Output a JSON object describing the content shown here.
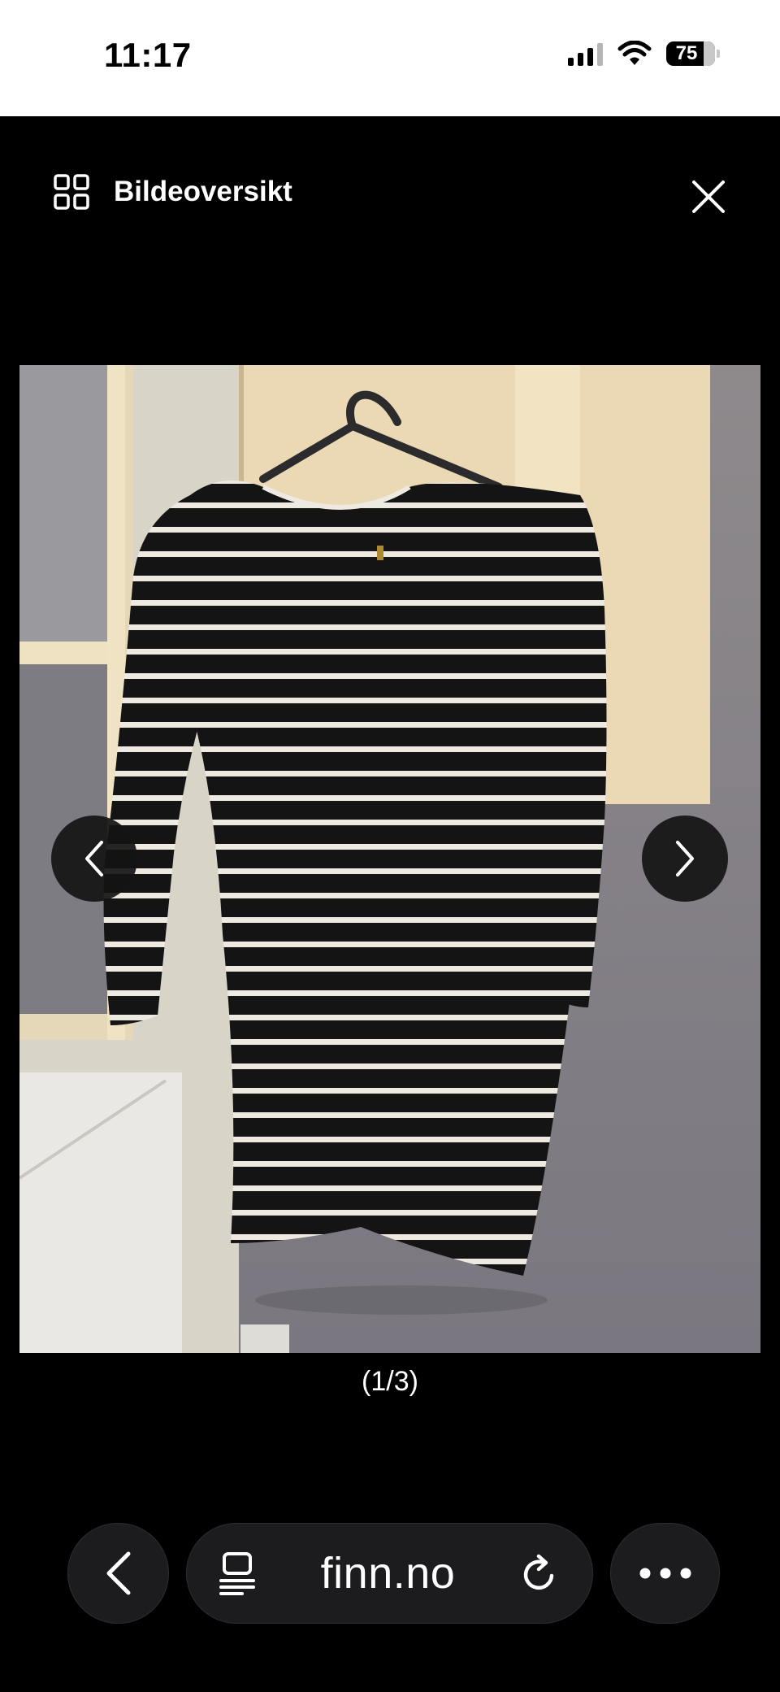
{
  "status_bar": {
    "time": "11:17",
    "battery": "75"
  },
  "viewer": {
    "overview_label": "Bildeoversikt",
    "counter": "(1/3)"
  },
  "browser_bar": {
    "url": "finn.no"
  },
  "colors": {
    "background": "#000000",
    "status_bar": "#ffffff",
    "button_bg": "#1c1c1e"
  }
}
